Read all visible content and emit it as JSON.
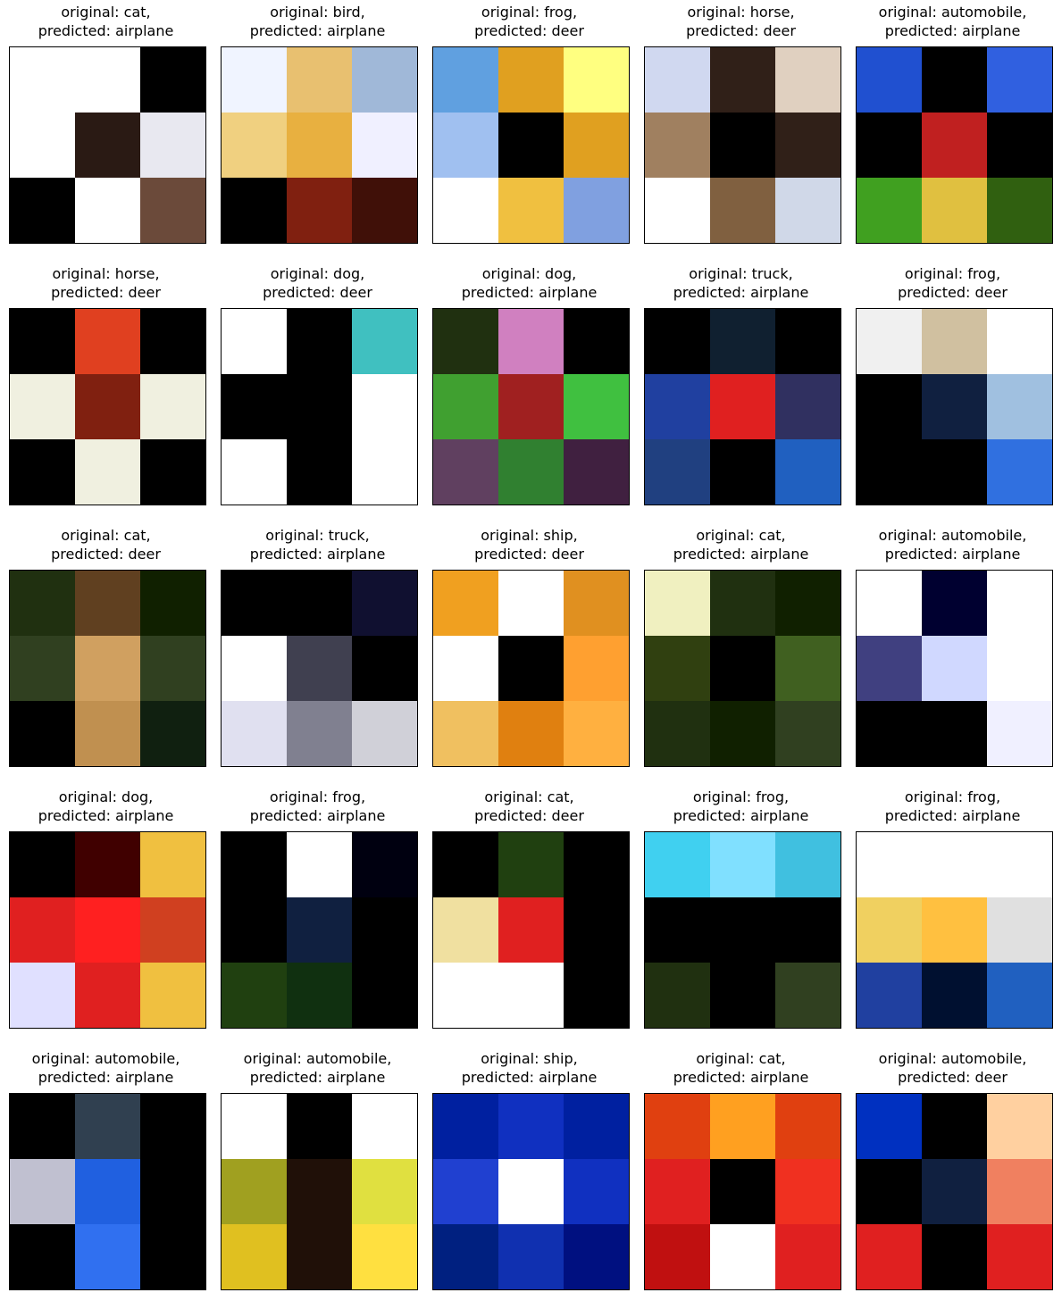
{
  "figure": {
    "panels": [
      {
        "original": "cat",
        "predicted": "airplane",
        "scene": [
          "#ffffff",
          "#ffffff",
          "#000000",
          "#ffffff",
          "#2a1a14",
          "#e8e8f0",
          "#000000",
          "#ffffff",
          "#6b4a3a"
        ]
      },
      {
        "original": "bird",
        "predicted": "airplane",
        "scene": [
          "#f0f4ff",
          "#e8c070",
          "#a0b8d8",
          "#f0d080",
          "#e8b040",
          "#f0f0ff",
          "#000000",
          "#802010",
          "#401008"
        ]
      },
      {
        "original": "frog",
        "predicted": "deer",
        "scene": [
          "#60a0e0",
          "#e0a020",
          "#ffff80",
          "#a0c0f0",
          "#000000",
          "#e0a020",
          "#ffffff",
          "#f0c040",
          "#80a0e0"
        ]
      },
      {
        "original": "horse",
        "predicted": "deer",
        "scene": [
          "#d0d8f0",
          "#302018",
          "#e0d0c0",
          "#a08060",
          "#000000",
          "#302018",
          "#ffffff",
          "#806040",
          "#d0d8e8"
        ]
      },
      {
        "original": "automobile",
        "predicted": "airplane",
        "scene": [
          "#2050d0",
          "#000000",
          "#3060e0",
          "#000000",
          "#c02020",
          "#000000",
          "#40a020",
          "#e0c040",
          "#306010"
        ]
      },
      {
        "original": "horse",
        "predicted": "deer",
        "scene": [
          "#000000",
          "#e04020",
          "#000000",
          "#f0f0e0",
          "#802010",
          "#f0f0e0",
          "#000000",
          "#f0f0e0",
          "#000000"
        ]
      },
      {
        "original": "dog",
        "predicted": "deer",
        "scene": [
          "#ffffff",
          "#000000",
          "#40c0c0",
          "#000000",
          "#000000",
          "#ffffff",
          "#ffffff",
          "#000000",
          "#ffffff"
        ]
      },
      {
        "original": "dog",
        "predicted": "airplane",
        "scene": [
          "#203010",
          "#d080c0",
          "#000000",
          "#40a030",
          "#a02020",
          "#40c040",
          "#604060",
          "#308030",
          "#402040"
        ]
      },
      {
        "original": "truck",
        "predicted": "airplane",
        "scene": [
          "#000000",
          "#102030",
          "#000000",
          "#2040a0",
          "#e02020",
          "#303060",
          "#204080",
          "#000000",
          "#2060c0"
        ]
      },
      {
        "original": "frog",
        "predicted": "deer",
        "scene": [
          "#f0f0f0",
          "#d0c0a0",
          "#ffffff",
          "#000000",
          "#102040",
          "#a0c0e0",
          "#000000",
          "#000000",
          "#3070e0"
        ]
      },
      {
        "original": "cat",
        "predicted": "deer",
        "scene": [
          "#203010",
          "#604020",
          "#102000",
          "#304020",
          "#d0a060",
          "#304020",
          "#000000",
          "#c09050",
          "#102010"
        ]
      },
      {
        "original": "truck",
        "predicted": "airplane",
        "scene": [
          "#000000",
          "#000000",
          "#101030",
          "#ffffff",
          "#404050",
          "#000000",
          "#e0e0f0",
          "#808090",
          "#d0d0d8"
        ]
      },
      {
        "original": "ship",
        "predicted": "deer",
        "scene": [
          "#f0a020",
          "#ffffff",
          "#e09020",
          "#ffffff",
          "#000000",
          "#ffa030",
          "#f0c060",
          "#e08010",
          "#ffb040"
        ]
      },
      {
        "original": "cat",
        "predicted": "airplane",
        "scene": [
          "#f0f0c0",
          "#203010",
          "#102000",
          "#304010",
          "#000000",
          "#406020",
          "#203010",
          "#102000",
          "#304020"
        ]
      },
      {
        "original": "automobile",
        "predicted": "airplane",
        "scene": [
          "#ffffff",
          "#000030",
          "#ffffff",
          "#404080",
          "#d0d8ff",
          "#ffffff",
          "#000000",
          "#000000",
          "#f0f0ff"
        ]
      },
      {
        "original": "dog",
        "predicted": "airplane",
        "scene": [
          "#000000",
          "#400000",
          "#f0c040",
          "#e02020",
          "#ff2020",
          "#d04020",
          "#e0e0ff",
          "#e02020",
          "#f0c040"
        ]
      },
      {
        "original": "frog",
        "predicted": "airplane",
        "scene": [
          "#000000",
          "#ffffff",
          "#000010",
          "#000000",
          "#102040",
          "#000000",
          "#204010",
          "#103010",
          "#000000"
        ]
      },
      {
        "original": "cat",
        "predicted": "deer",
        "scene": [
          "#000000",
          "#204010",
          "#000000",
          "#f0e0a0",
          "#e02020",
          "#000000",
          "#ffffff",
          "#ffffff",
          "#000000"
        ]
      },
      {
        "original": "frog",
        "predicted": "airplane",
        "scene": [
          "#40d0f0",
          "#80e0ff",
          "#40c0e0",
          "#000000",
          "#000000",
          "#000000",
          "#203010",
          "#000000",
          "#304020"
        ]
      },
      {
        "original": "frog",
        "predicted": "airplane",
        "scene": [
          "#ffffff",
          "#ffffff",
          "#ffffff",
          "#f0d060",
          "#ffc040",
          "#e0e0e0",
          "#2040a0",
          "#001030",
          "#2060c0"
        ]
      },
      {
        "original": "automobile",
        "predicted": "airplane",
        "scene": [
          "#000000",
          "#304050",
          "#000000",
          "#c0c0d0",
          "#2060e0",
          "#000000",
          "#000000",
          "#3070f0",
          "#000000"
        ]
      },
      {
        "original": "automobile",
        "predicted": "airplane",
        "scene": [
          "#ffffff",
          "#000000",
          "#ffffff",
          "#a0a020",
          "#201008",
          "#e0e040",
          "#e0c020",
          "#201008",
          "#ffe040"
        ]
      },
      {
        "original": "ship",
        "predicted": "airplane",
        "scene": [
          "#0020a0",
          "#1030c0",
          "#0020a0",
          "#2040d0",
          "#ffffff",
          "#1030c0",
          "#002080",
          "#1030b0",
          "#001080"
        ]
      },
      {
        "original": "cat",
        "predicted": "airplane",
        "scene": [
          "#e04010",
          "#ffa020",
          "#e04010",
          "#e02020",
          "#000000",
          "#f03020",
          "#c01010",
          "#ffffff",
          "#e02020"
        ]
      },
      {
        "original": "automobile",
        "predicted": "deer",
        "scene": [
          "#0030c0",
          "#000000",
          "#ffd0a0",
          "#000000",
          "#102040",
          "#f08060",
          "#e02020",
          "#000000",
          "#e02020"
        ]
      }
    ]
  }
}
